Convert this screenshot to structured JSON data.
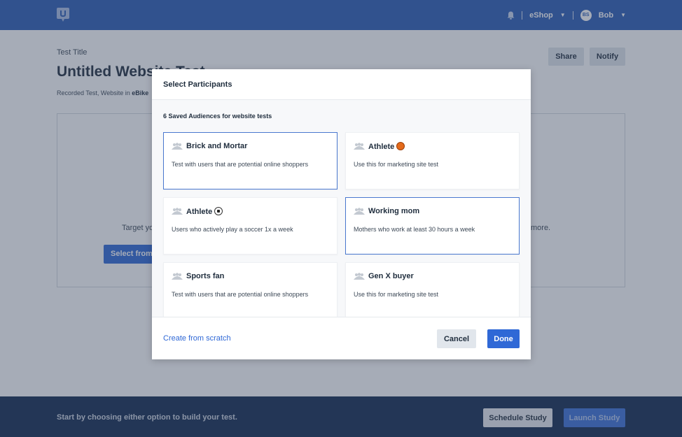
{
  "colors": {
    "topbar": "#2b5bb5",
    "primary": "#2f68d6",
    "bottombar": "#12284f",
    "selected_border": "#4a78cf"
  },
  "header": {
    "logo_icon": "u-logo-icon",
    "notification_icon": "bell-icon",
    "workspace": "eShop",
    "user_initials": "BS",
    "user_name": "Bob"
  },
  "page": {
    "test_label": "Test Title",
    "title": "Untitled Website Test",
    "subtitle_prefix": "Recorded Test, Website in",
    "subtitle_project": "eBike",
    "share_label": "Share",
    "notify_label": "Notify",
    "target_text_left": "Target yo",
    "target_text_right": "more.",
    "select_button": "Select from"
  },
  "bottom": {
    "hint": "Start by choosing either option to build your test.",
    "schedule_label": "Schedule Study",
    "launch_label": "Launch Study"
  },
  "modal": {
    "title": "Select Participants",
    "saved_label": "6 Saved Audiences for website tests",
    "audiences": [
      {
        "name": "Brick and Mortar",
        "description": "Test with users that are potential online shoppers",
        "selected": true,
        "emoji": ""
      },
      {
        "name": "Athlete",
        "description": "Use this for marketing site test",
        "selected": false,
        "emoji": "basketball"
      },
      {
        "name": "Athlete",
        "description": "Users who actively play a soccer 1x a week",
        "selected": false,
        "emoji": "soccer"
      },
      {
        "name": "Working mom",
        "description": "Mothers who work at least 30 hours a week",
        "selected": true,
        "emoji": ""
      },
      {
        "name": "Sports fan",
        "description": "Test with users that are potential online shoppers",
        "selected": false,
        "emoji": ""
      },
      {
        "name": "Gen X buyer",
        "description": "Use this for marketing site test",
        "selected": false,
        "emoji": ""
      }
    ],
    "create_link": "Create from scratch",
    "cancel_label": "Cancel",
    "done_label": "Done"
  }
}
